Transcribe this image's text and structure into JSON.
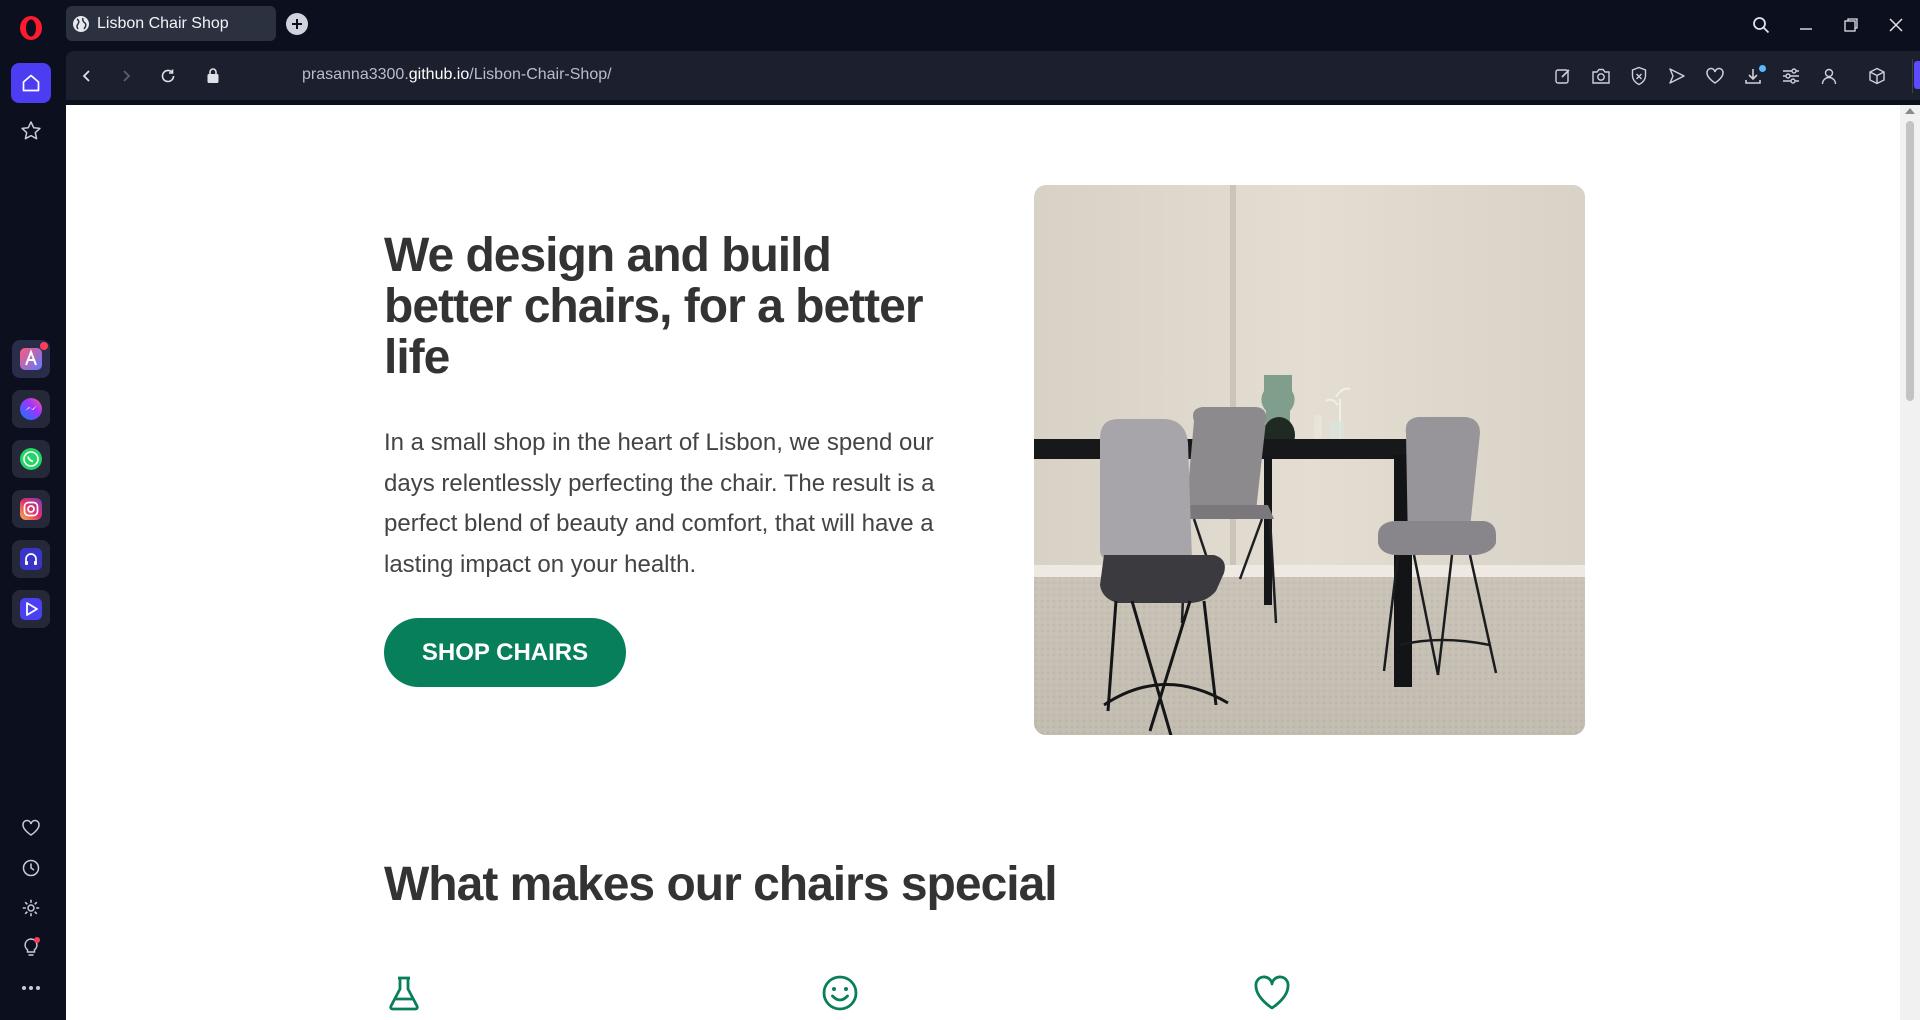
{
  "browser": {
    "tab_title": "Lisbon Chair Shop",
    "url_prefix": "prasanna3300.",
    "url_domain": "github.io",
    "url_path": "/Lisbon-Chair-Shop/",
    "accent_color": "#4c3df2"
  },
  "sidebar": {
    "icons": [
      "home-icon",
      "star-icon",
      "aria-icon",
      "messenger-icon",
      "whatsapp-icon",
      "instagram-icon",
      "music-icon",
      "player-icon",
      "heart-icon",
      "history-icon",
      "settings-icon",
      "lightbulb-icon",
      "more-icon"
    ]
  },
  "hero": {
    "title": "We design and build better chairs, for a better life",
    "text": "In a small shop in the heart of Lisbon, we spend our days relentlessly perfecting the chair. The result is a perfect blend of beauty and comfort, that will have a lasting impact on your health.",
    "button_label": "SHOP CHAIRS",
    "button_color": "#087f5b"
  },
  "features": {
    "title": "What makes our chairs special",
    "icons": [
      "flask-icon",
      "smile-icon",
      "heart-icon"
    ],
    "icon_color": "#087f5b"
  }
}
